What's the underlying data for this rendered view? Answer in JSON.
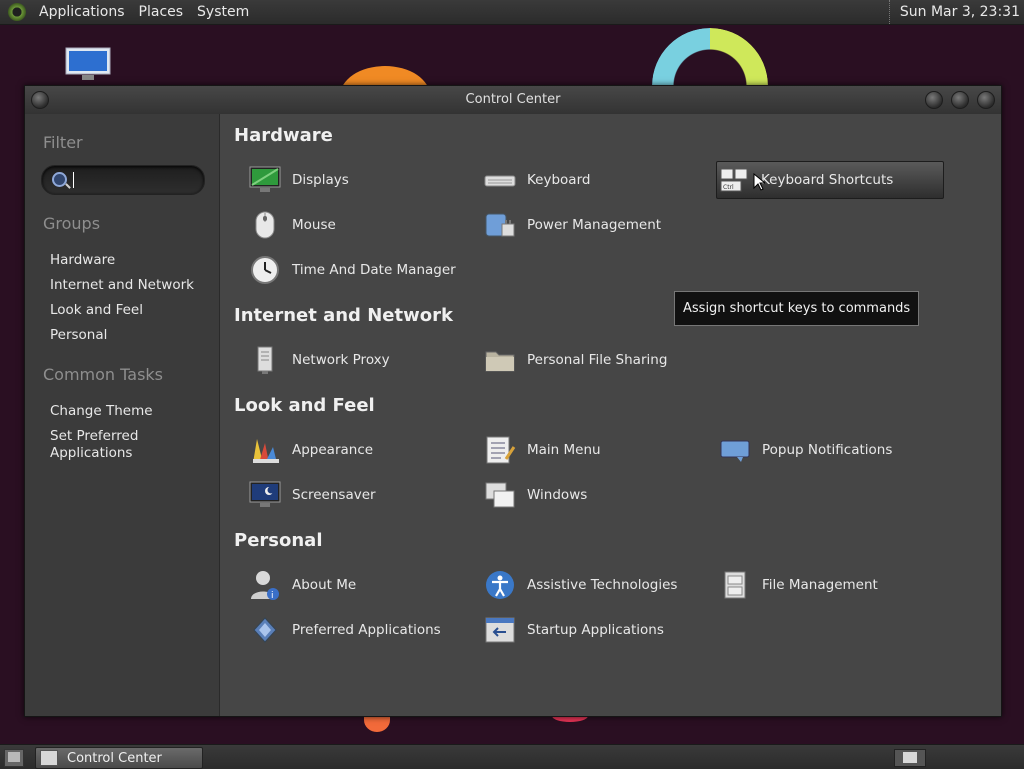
{
  "top_panel": {
    "menus": [
      "Applications",
      "Places",
      "System"
    ],
    "clock": "Sun Mar  3, 23:31"
  },
  "window": {
    "title": "Control Center"
  },
  "sidebar": {
    "filter_label": "Filter",
    "search": {
      "value": "",
      "placeholder": ""
    },
    "groups_label": "Groups",
    "groups": [
      "Hardware",
      "Internet and Network",
      "Look and Feel",
      "Personal"
    ],
    "tasks_label": "Common Tasks",
    "tasks": [
      "Change Theme",
      "Set Preferred Applications"
    ]
  },
  "sections": {
    "hardware": {
      "title": "Hardware",
      "items": [
        "Displays",
        "Keyboard",
        "Keyboard Shortcuts",
        "Mouse",
        "Power Management",
        "Time And Date Manager"
      ]
    },
    "internet": {
      "title": "Internet and Network",
      "items": [
        "Network Proxy",
        "Personal File Sharing"
      ]
    },
    "look": {
      "title": "Look and Feel",
      "items": [
        "Appearance",
        "Main Menu",
        "Popup Notifications",
        "Screensaver",
        "Windows"
      ]
    },
    "personal": {
      "title": "Personal",
      "items": [
        "About Me",
        "Assistive Technologies",
        "File Management",
        "Preferred Applications",
        "Startup Applications"
      ]
    }
  },
  "tooltip": "Assign shortcut keys to commands",
  "taskbar": {
    "active_window": "Control Center"
  },
  "icons": {
    "displays": "monitor-icon",
    "keyboard": "keyboard-icon",
    "shortcuts": "keyboard-shortcuts-icon",
    "mouse": "mouse-icon",
    "power": "power-management-icon",
    "time": "clock-icon",
    "proxy": "network-proxy-icon",
    "filesharing": "folder-share-icon",
    "appearance": "palette-icon",
    "mainmenu": "menu-editor-icon",
    "popup": "notification-icon",
    "screensaver": "screensaver-icon",
    "windows": "windows-icon",
    "aboutme": "user-info-icon",
    "assistive": "accessibility-icon",
    "filemgmt": "file-cabinet-icon",
    "preferred": "preferred-apps-icon",
    "startup": "startup-apps-icon"
  }
}
